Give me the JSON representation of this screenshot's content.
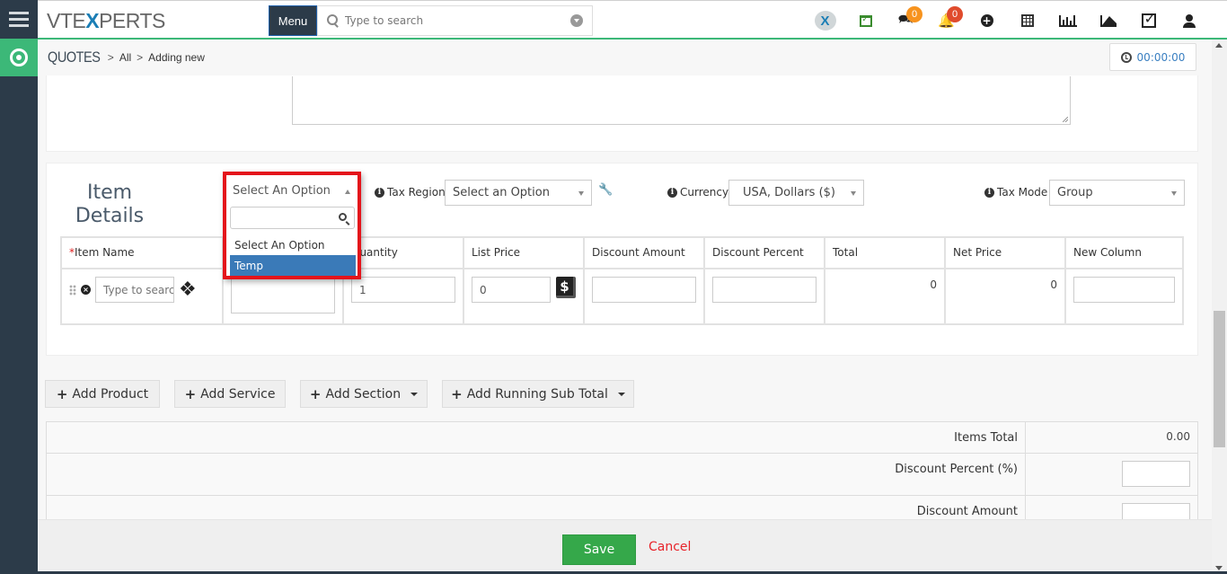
{
  "app": {
    "logo_prefix": "VTE",
    "logo_x": "X",
    "logo_suffix": "PERTS",
    "menu_label": "Menu",
    "search_placeholder": "Type to search"
  },
  "top_icons": [
    {
      "name": "vtexperts-icon"
    },
    {
      "name": "calendar-check-icon"
    },
    {
      "name": "chat-icon",
      "badge": "0",
      "badge_color": "#f7931e"
    },
    {
      "name": "bell-icon",
      "badge": "0",
      "badge_color": "#e04b2c"
    },
    {
      "name": "add-circle-icon"
    },
    {
      "name": "calendar-icon"
    },
    {
      "name": "bar-chart-icon"
    },
    {
      "name": "area-chart-icon"
    },
    {
      "name": "tasks-icon"
    },
    {
      "name": "user-icon"
    }
  ],
  "breadcrumb": {
    "module": "QUOTES",
    "sep": ">",
    "items": [
      "All",
      "Adding new"
    ]
  },
  "timer": "00:00:00",
  "item_details": {
    "title_line1": "Item",
    "title_line2": "Details",
    "template_select": {
      "value": "Select An Option",
      "search_value": "",
      "options": [
        "Select An Option",
        "Temp"
      ],
      "highlighted": "Temp"
    },
    "tax_region": {
      "label": "Tax Region",
      "value": "Select an Option"
    },
    "currency": {
      "label": "Currency",
      "value": "USA, Dollars ($)"
    },
    "tax_mode": {
      "label": "Tax Mode",
      "value": "Group"
    }
  },
  "table": {
    "columns": [
      "Item Name",
      "",
      "Quantity",
      "List Price",
      "Discount Amount",
      "Discount Percent",
      "Total",
      "Net Price",
      "New Column"
    ],
    "required_mark": "*",
    "row": {
      "item_name_placeholder": "Type to search",
      "quantity": "1",
      "list_price": "0",
      "discount_amount": "",
      "discount_percent": "",
      "total": "0",
      "net_price": "0",
      "new_column": ""
    }
  },
  "buttons": {
    "add_product": "Add Product",
    "add_service": "Add Service",
    "add_section": "Add Section",
    "add_running_sub_total": "Add Running Sub Total"
  },
  "totals": {
    "items_total_label": "Items Total",
    "items_total_value": "0.00",
    "discount_percent_label": "Discount Percent (%)",
    "discount_percent_value": "",
    "discount_amount_label": "Discount Amount",
    "discount_amount_value": ""
  },
  "footer": {
    "save": "Save",
    "cancel": "Cancel"
  }
}
